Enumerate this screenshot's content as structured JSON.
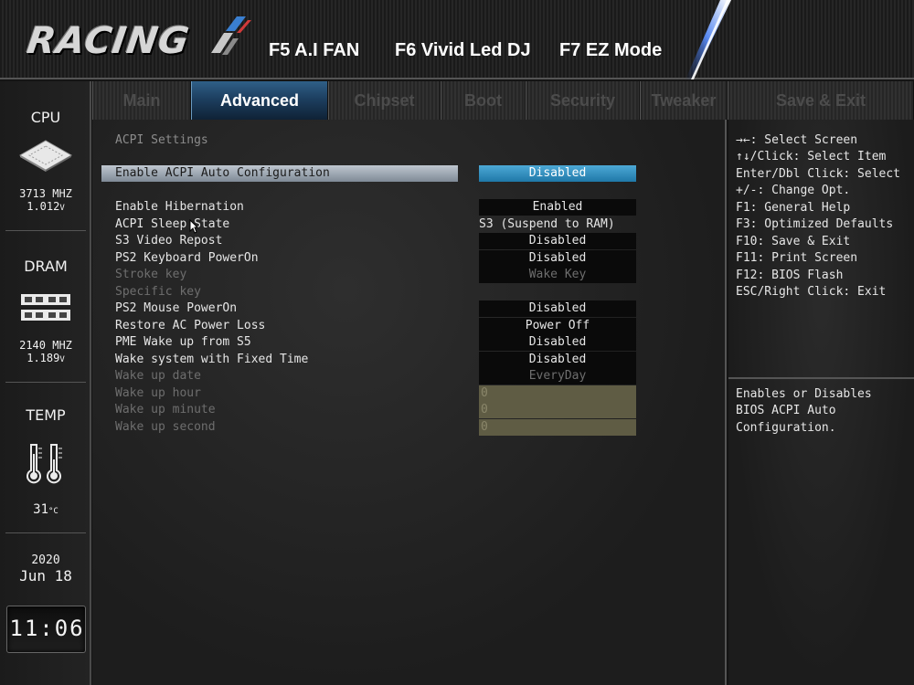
{
  "header": {
    "logo_text": "RACING",
    "hotkeys": [
      "F5 A.I FAN",
      "F6 Vivid Led DJ",
      "F7 EZ Mode"
    ]
  },
  "sidebar": {
    "cpu": {
      "title": "CPU",
      "freq": "3713 MHZ",
      "volt": "1.012",
      "volt_unit": "V"
    },
    "dram": {
      "title": "DRAM",
      "freq": "2140 MHZ",
      "volt": "1.189",
      "volt_unit": "V"
    },
    "temp": {
      "title": "TEMP",
      "value": "31",
      "unit": "°C"
    },
    "date": {
      "year": "2020",
      "month_day": "Jun 18"
    },
    "clock": {
      "time": "11:06"
    }
  },
  "tabs": [
    {
      "label": "Main",
      "active": false
    },
    {
      "label": "Advanced",
      "active": true
    },
    {
      "label": "Chipset",
      "active": false
    },
    {
      "label": "Boot",
      "active": false
    },
    {
      "label": "Security",
      "active": false
    },
    {
      "label": "Tweaker",
      "active": false
    },
    {
      "label": "Save & Exit",
      "active": false
    }
  ],
  "main": {
    "section_title": "ACPI Settings",
    "rows": [
      {
        "label": "Enable ACPI Auto Configuration",
        "value": "Disabled",
        "state": "selected"
      },
      {
        "label": "Enable Hibernation",
        "value": "Enabled",
        "state": "normal"
      },
      {
        "label": "ACPI Sleep State",
        "value": "S3 (Suspend to RAM)",
        "state": "normal",
        "style": "plain"
      },
      {
        "label": "S3 Video Repost",
        "value": "Disabled",
        "state": "normal"
      },
      {
        "label": "PS2 Keyboard PowerOn",
        "value": "Disabled",
        "state": "normal"
      },
      {
        "label": "Stroke key",
        "value": "Wake Key",
        "state": "dim"
      },
      {
        "label": "Specific key",
        "value": "",
        "state": "dim",
        "style": "none"
      },
      {
        "label": "PS2 Mouse PowerOn",
        "value": "Disabled",
        "state": "normal"
      },
      {
        "label": "Restore AC Power Loss",
        "value": "Power Off",
        "state": "normal"
      },
      {
        "label": "PME Wake up from S5",
        "value": "Disabled",
        "state": "normal"
      },
      {
        "label": "Wake system with Fixed Time",
        "value": "Disabled",
        "state": "normal"
      },
      {
        "label": "Wake up date",
        "value": "EveryDay",
        "state": "dim"
      },
      {
        "label": "Wake up hour",
        "value": "0",
        "state": "dim",
        "style": "num"
      },
      {
        "label": "Wake up minute",
        "value": "0",
        "state": "dim",
        "style": "num"
      },
      {
        "label": "Wake up second",
        "value": "0",
        "state": "dim",
        "style": "num"
      }
    ]
  },
  "help": {
    "keys": [
      "→←: Select Screen",
      "↑↓/Click: Select Item",
      "Enter/Dbl Click: Select",
      "+/-: Change Opt.",
      "F1: General Help",
      "F3: Optimized Defaults",
      "F10: Save & Exit",
      "F11: Print Screen",
      "F12: BIOS Flash",
      "ESC/Right Click: Exit"
    ],
    "description": [
      "Enables or Disables",
      "BIOS ACPI Auto",
      "Configuration."
    ]
  },
  "colors": {
    "accent_blue": "#2a8fc2",
    "active_tab": "#1d3f60",
    "disabled_field": "#5f5c44"
  }
}
